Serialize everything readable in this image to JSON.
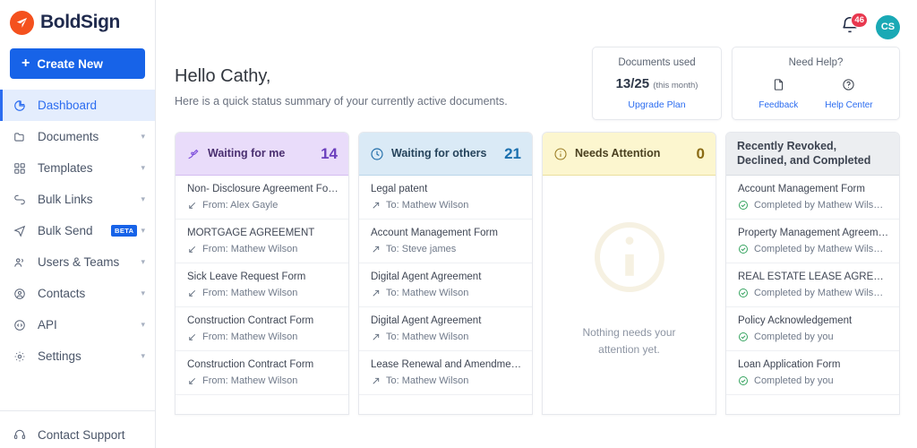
{
  "brand": {
    "name": "BoldSign",
    "logo_icon": "boldsign-logo-icon",
    "logo_color": "#f4511e"
  },
  "sidebar": {
    "create_button": {
      "label": "Create New",
      "icon": "plus-icon",
      "color": "#1763e8"
    },
    "items": [
      {
        "label": "Dashboard",
        "icon": "dashboard-pie-icon",
        "active": true,
        "chevron": false
      },
      {
        "label": "Documents",
        "icon": "folder-icon",
        "active": false,
        "chevron": true
      },
      {
        "label": "Templates",
        "icon": "grid-icon",
        "active": false,
        "chevron": true
      },
      {
        "label": "Bulk Links",
        "icon": "link-icon",
        "active": false,
        "chevron": true
      },
      {
        "label": "Bulk Send",
        "icon": "send-icon",
        "active": false,
        "chevron": true,
        "badge": "BETA"
      },
      {
        "label": "Users & Teams",
        "icon": "users-icon",
        "active": false,
        "chevron": true
      },
      {
        "label": "Contacts",
        "icon": "contact-circle-icon",
        "active": false,
        "chevron": true
      },
      {
        "label": "API",
        "icon": "code-circle-icon",
        "active": false,
        "chevron": true
      },
      {
        "label": "Settings",
        "icon": "gear-icon",
        "active": false,
        "chevron": true
      }
    ],
    "footer": {
      "label": "Contact Support",
      "icon": "headset-icon"
    }
  },
  "topbar": {
    "notifications": {
      "icon": "bell-icon",
      "count": "46",
      "badge_color": "#e8384f"
    },
    "avatar": {
      "initials": "CS",
      "color": "#1aa9b5"
    }
  },
  "hero": {
    "greeting": "Hello Cathy,",
    "subtitle": "Here is a quick status summary of your currently active documents.",
    "documents_card": {
      "title": "Documents used",
      "count": "13/25",
      "period": "(this month)",
      "link": "Upgrade Plan"
    },
    "help_card": {
      "title": "Need Help?",
      "actions": [
        {
          "label": "Feedback",
          "icon": "document-icon"
        },
        {
          "label": "Help Center",
          "icon": "question-circle-icon"
        }
      ]
    }
  },
  "columns": [
    {
      "key": "waiting-for-me",
      "title": "Waiting for me",
      "count": "14",
      "icon": "signature-pen-icon",
      "theme": "purple",
      "rows": [
        {
          "title": "Non- Disclosure Agreement Form",
          "meta": "From: Alex Gayle",
          "meta_icon": "arrow-in-icon"
        },
        {
          "title": "MORTGAGE AGREEMENT",
          "meta": "From: Mathew Wilson",
          "meta_icon": "arrow-in-icon"
        },
        {
          "title": "Sick Leave Request Form",
          "meta": "From: Mathew Wilson",
          "meta_icon": "arrow-in-icon"
        },
        {
          "title": "Construction Contract Form",
          "meta": "From: Mathew Wilson",
          "meta_icon": "arrow-in-icon"
        },
        {
          "title": "Construction Contract Form",
          "meta": "From: Mathew Wilson",
          "meta_icon": "arrow-in-icon"
        }
      ]
    },
    {
      "key": "waiting-for-others",
      "title": "Waiting for others",
      "count": "21",
      "icon": "clock-icon",
      "theme": "blue",
      "rows": [
        {
          "title": "Legal patent",
          "meta": "To: Mathew Wilson",
          "meta_icon": "arrow-out-icon"
        },
        {
          "title": "Account Management Form",
          "meta": "To: Steve james",
          "meta_icon": "arrow-out-icon"
        },
        {
          "title": "Digital Agent Agreement",
          "meta": "To: Mathew Wilson",
          "meta_icon": "arrow-out-icon"
        },
        {
          "title": "Digital Agent Agreement",
          "meta": "To: Mathew Wilson",
          "meta_icon": "arrow-out-icon"
        },
        {
          "title": "Lease Renewal and Amendmen…",
          "meta": "To: Mathew Wilson",
          "meta_icon": "arrow-out-icon"
        }
      ]
    },
    {
      "key": "needs-attention",
      "title": "Needs Attention",
      "count": "0",
      "icon": "info-circle-icon",
      "theme": "yellow",
      "empty": {
        "icon": "info-circle-large-icon",
        "text": "Nothing needs your attention yet."
      },
      "rows": []
    },
    {
      "key": "recently-completed",
      "title": "Recently Revoked, Declined, and Completed",
      "count": "",
      "icon": "",
      "theme": "grey",
      "rows": [
        {
          "title": "Account Management Form",
          "meta": "Completed by Mathew Wils…",
          "meta_icon": "check-circle-icon"
        },
        {
          "title": "Property Management Agreement",
          "meta": "Completed by Mathew Wils…",
          "meta_icon": "check-circle-icon"
        },
        {
          "title": "REAL ESTATE LEASE AGREEME…",
          "meta": "Completed by Mathew Wils…",
          "meta_icon": "check-circle-icon"
        },
        {
          "title": "Policy Acknowledgement",
          "meta": "Completed by you",
          "meta_icon": "check-circle-icon"
        },
        {
          "title": "Loan Application Form",
          "meta": "Completed by you",
          "meta_icon": "check-circle-icon"
        }
      ]
    }
  ]
}
